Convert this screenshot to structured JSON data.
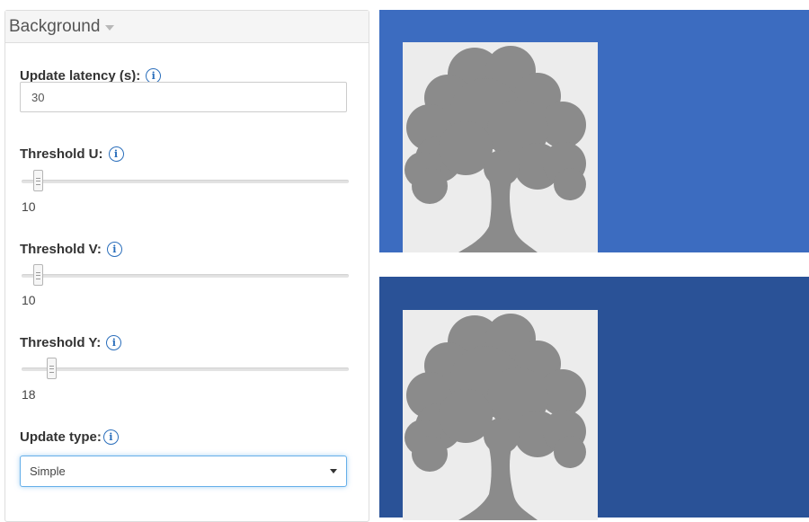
{
  "panel": {
    "title": "Background"
  },
  "latency": {
    "label": "Update latency (s):",
    "value": "30"
  },
  "threshold_u": {
    "label": "Threshold U:",
    "value": "10",
    "position": 0.05
  },
  "threshold_v": {
    "label": "Threshold V:",
    "value": "10",
    "position": 0.05
  },
  "threshold_y": {
    "label": "Threshold Y:",
    "value": "18",
    "position": 0.09
  },
  "update_type": {
    "label": "Update type:",
    "selected": "Simple"
  },
  "icons": {
    "info": "info-icon",
    "panel_toggle": "chevron-down-icon",
    "select_arrow": "caret-down-icon",
    "preview": "tree-icon"
  },
  "colors": {
    "info_blue": "#2a6ebb",
    "preview_top_bg": "#3c6cc0",
    "preview_bottom_bg": "#2a5297",
    "thumb_bg": "#ececec",
    "tree": "#8b8b8b"
  }
}
